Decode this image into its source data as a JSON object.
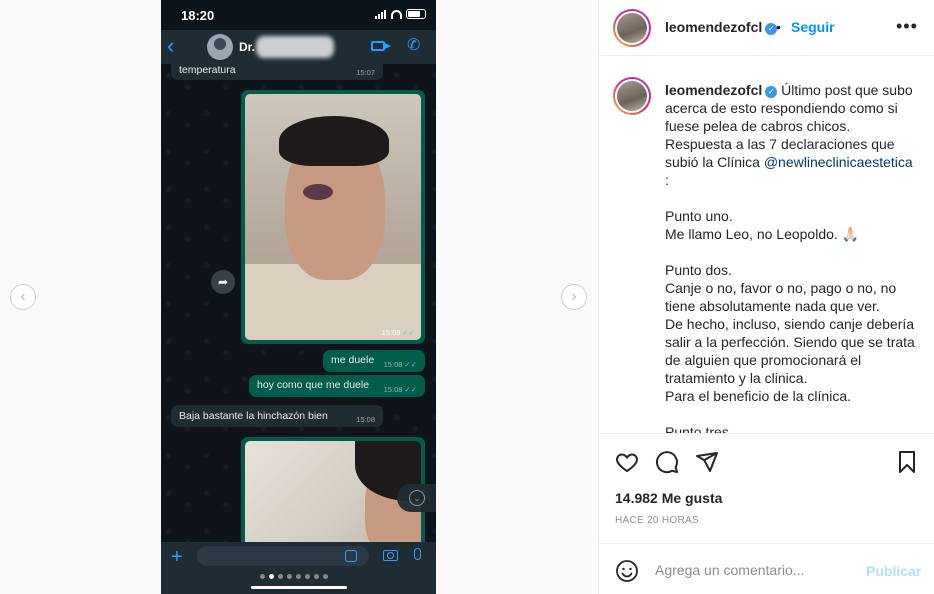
{
  "phone": {
    "time": "18:20",
    "contact_name": "Dr.",
    "messages": {
      "temperatura": {
        "text": "temperatura",
        "time": "15:07"
      },
      "photo1_time": "15:08",
      "me_duele": {
        "text": "me duele",
        "time": "15:08"
      },
      "hoy": {
        "text": "hoy como que me duele",
        "time": "15:08"
      },
      "baja": {
        "text": "Baja bastante la hinchazón bien",
        "time": "15:08"
      }
    },
    "ticks": "✓✓",
    "carousel_dots": 8,
    "active_dot": 1
  },
  "post": {
    "username": "leomendezofcl",
    "separator": "•",
    "follow_label": "Seguir",
    "more_label": "•••",
    "caption": {
      "intro": "Último post que subo acerca de esto respondiendo como si fuese pelea de cabros chicos.",
      "line2_prefix": "Respuesta a las 7 declaraciones que subió la Clínica ",
      "mention": "@newlineclinicaestetica",
      "line2_suffix": " :",
      "p1_title": "Punto uno.",
      "p1_text": "Me llamo Leo, no Leopoldo. 🙏🏻",
      "p2_title": "Punto dos.",
      "p2_text1": "Canje o no, favor o no, pago o no, no tiene absolutamente nada que ver.",
      "p2_text2": "De hecho, incluso, siendo canje debería salir a la perfección. Siendo que se trata de alguien que promocionará el tratamiento y la clinica.",
      "p2_text3": "Para el beneficio de la clínica.",
      "p3_title": "Punto tres."
    },
    "likes": "14.982 Me gusta",
    "time_ago": "HACE 20 HORAS",
    "comment_placeholder": "Agrega un comentario...",
    "publish_label": "Publicar"
  }
}
